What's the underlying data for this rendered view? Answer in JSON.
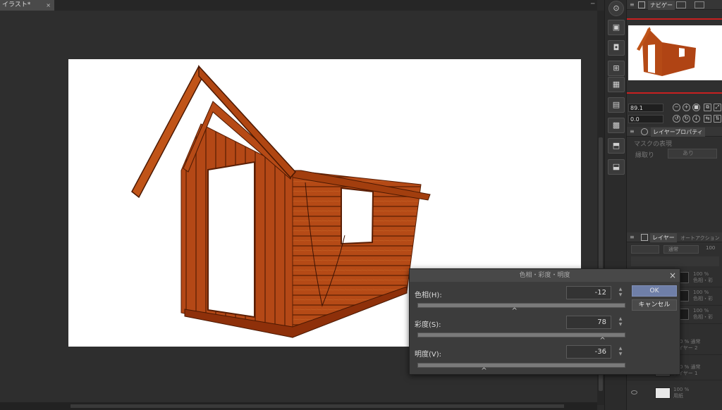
{
  "document": {
    "tab_label": "イラスト*",
    "tab_close": "×"
  },
  "window_menu": "─",
  "navigator": {
    "tab_label": "ナビゲー",
    "zoom_value": "89.1",
    "rotation_value": "0.0"
  },
  "layer_property": {
    "tab_label": "レイヤープロパティ",
    "effect_label": "マスクの表現",
    "border_label": "縁取り",
    "border_value": "あり"
  },
  "layers_panel": {
    "tab_label": "レイヤー",
    "tab2_label": "オートアクション",
    "blend_mode": "通常",
    "opacity": "100",
    "rows": [
      {
        "text": "100 %\n色相・彩"
      },
      {
        "text": "100 %\n色相・彩"
      },
      {
        "text": "100 %\n色相・彩"
      },
      {
        "text": "100 % 通常\nレイヤー 2"
      },
      {
        "text": "100 % 通常\nレイヤー 1"
      },
      {
        "text": "100 %\n用紙"
      }
    ]
  },
  "dialog": {
    "title": "色相・彩度・明度",
    "close_label": "×",
    "hue_label": "色相(H):",
    "hue_value": "-12",
    "saturation_label": "彩度(S):",
    "saturation_value": "78",
    "brightness_label": "明度(V):",
    "brightness_value": "-36",
    "ok_label": "OK",
    "cancel_label": "キャンセル",
    "hue_level": 0.467,
    "saturation_level": 0.89,
    "brightness_level": 0.32
  },
  "tools": [
    {
      "icon": "zoom-icon"
    },
    {
      "icon": "new-folder-icon"
    },
    {
      "icon": "camera-icon"
    },
    {
      "icon": "material-icon"
    },
    {
      "icon": "grid-icon"
    },
    {
      "icon": "layer-copy-icon"
    },
    {
      "icon": "film-icon"
    },
    {
      "icon": "folder-up-icon"
    },
    {
      "icon": "folder-down-icon"
    }
  ],
  "colors": {
    "paper": "#ffffff",
    "wood": "#b84a14",
    "ok_button": "#6f7fa8",
    "accent_red": "#c82020"
  }
}
